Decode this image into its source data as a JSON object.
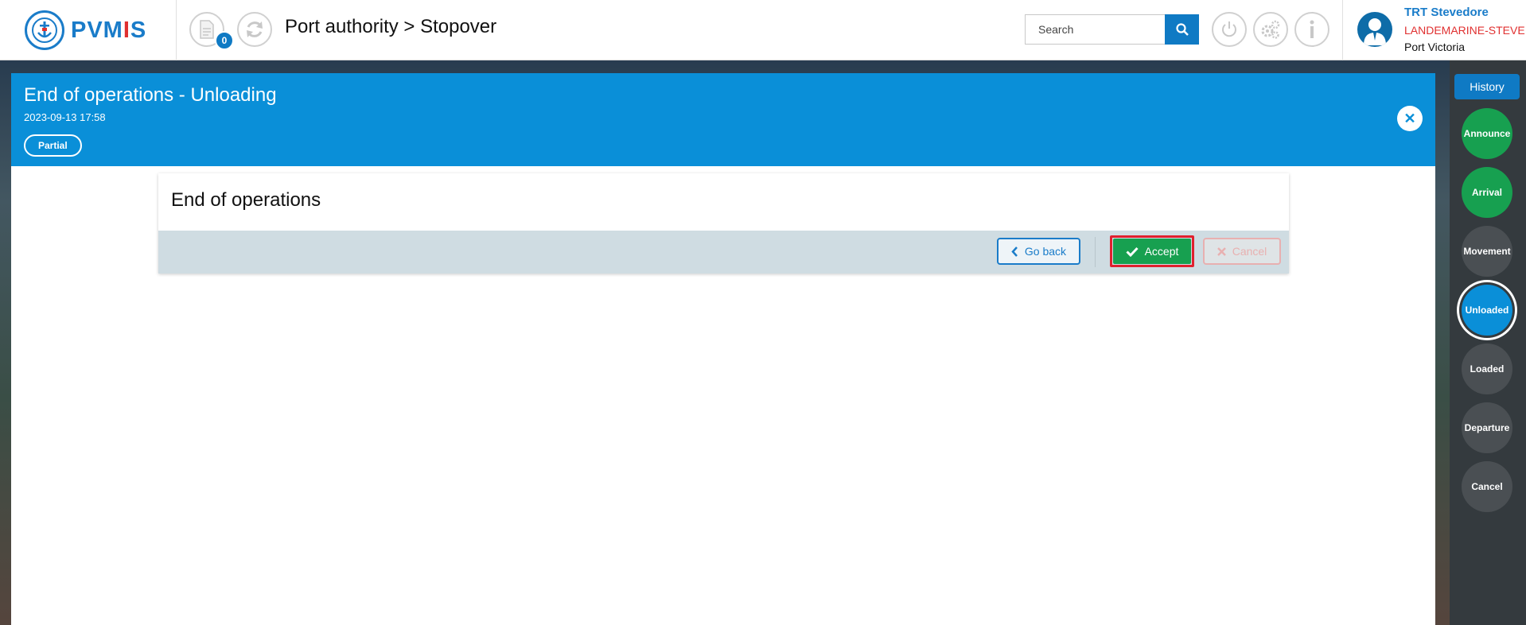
{
  "header": {
    "logo_text_left": "PVM",
    "logo_text_bar": "I",
    "logo_text_right": "S",
    "notification_count": "0",
    "breadcrumb": "Port authority > Stopover",
    "search": {
      "placeholder": "Search",
      "value": ""
    }
  },
  "user": {
    "name": "TRT Stevedore",
    "company": "LANDEMARINE-STEVE",
    "port": "Port Victoria"
  },
  "panel": {
    "title": "End of operations - Unloading",
    "date": "2023-09-13 17:58",
    "status_badge": "Partial",
    "close_label": "✕"
  },
  "card": {
    "title": "End of operations",
    "go_back_label": "Go back",
    "accept_label": "Accept",
    "cancel_label": "Cancel"
  },
  "sidebar": {
    "history_label": "History",
    "steps": [
      {
        "label": "Announce",
        "state": "done"
      },
      {
        "label": "Arrival",
        "state": "done"
      },
      {
        "label": "Movement",
        "state": "pending"
      },
      {
        "label": "Unloaded",
        "state": "active"
      },
      {
        "label": "Loaded",
        "state": "pending"
      },
      {
        "label": "Departure",
        "state": "pending"
      },
      {
        "label": "Cancel",
        "state": "pending"
      }
    ]
  },
  "colors": {
    "brand_blue": "#0f7ac4",
    "header_blue": "#0a8fd8",
    "accept_green": "#17a050",
    "highlight_red": "#e0202e",
    "company_red": "#e03030"
  }
}
